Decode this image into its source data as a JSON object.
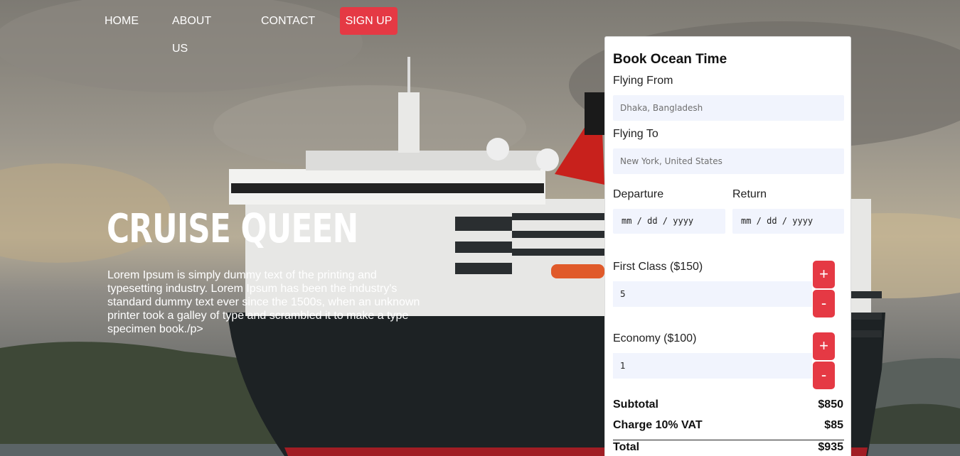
{
  "nav": {
    "home": "HOME",
    "about": "ABOUT US",
    "contact": "CONTACT",
    "signup": "SIGN UP"
  },
  "hero": {
    "title": "CRUISE QUEEN",
    "text": "Lorem Ipsum is simply dummy text of the printing and typesetting industry. Lorem Ipsum has been the industry's standard dummy text ever since the 1500s, when an unknown printer took a galley of type and scrambled it to make a type specimen book./p>"
  },
  "booking": {
    "title": "Book Ocean Time",
    "from_label": "Flying From",
    "from_placeholder": "Dhaka, Bangladesh",
    "to_label": "Flying To",
    "to_placeholder": "New York, United States",
    "departure_label": "Departure",
    "departure_value": "mm / dd / yyyy",
    "return_label": "Return",
    "return_value": "mm / dd / yyyy",
    "first_class": {
      "label": "First Class ($150)",
      "quantity": "5",
      "plus": "+",
      "minus": "-"
    },
    "economy": {
      "label": "Economy ($100)",
      "quantity": "1",
      "plus": "+",
      "minus": "-"
    },
    "subtotal_label": "Subtotal",
    "subtotal_value": "$850",
    "vat_label": "Charge 10% VAT",
    "vat_value": "$85",
    "total_label": "Total",
    "total_value": "$935"
  },
  "colors": {
    "accent": "#e53944",
    "input_bg": "#f1f4fd"
  }
}
